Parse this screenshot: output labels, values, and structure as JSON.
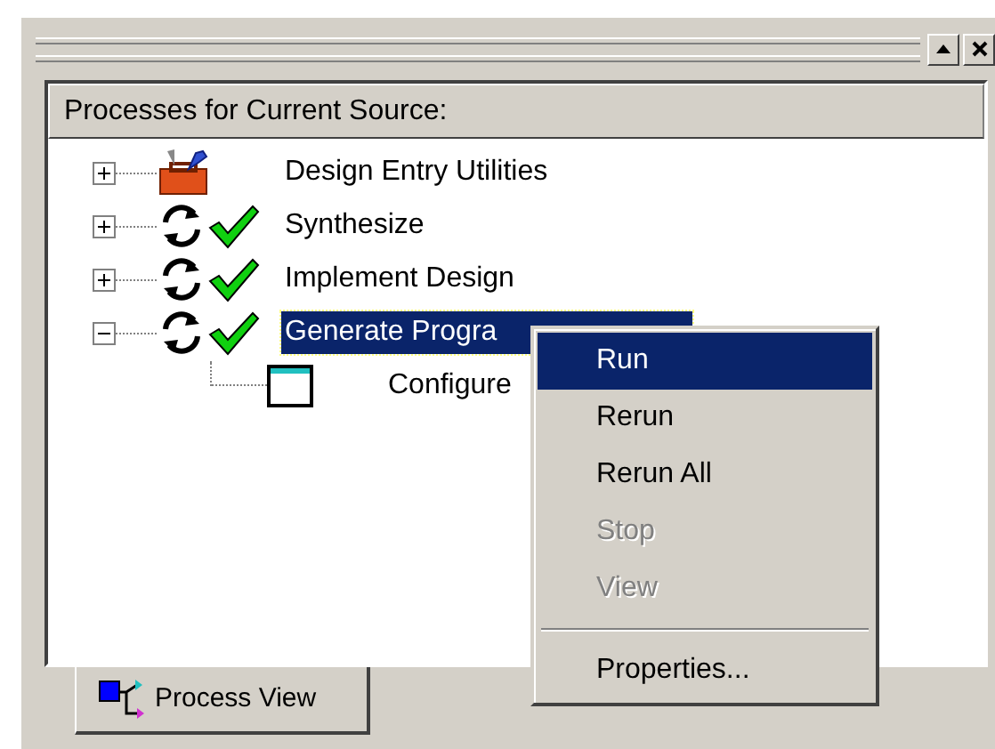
{
  "panel": {
    "header": "Processes for Current Source:"
  },
  "tree": [
    {
      "label": "Design Entry Utilities",
      "kind": "toolbox",
      "expanded": false,
      "selected": false,
      "done": false
    },
    {
      "label": "Synthesize",
      "kind": "process",
      "expanded": false,
      "selected": false,
      "done": true
    },
    {
      "label": "Implement Design",
      "kind": "process",
      "expanded": false,
      "selected": false,
      "done": true
    },
    {
      "label": "Generate Progra",
      "kind": "process",
      "expanded": true,
      "selected": true,
      "done": true,
      "children": [
        {
          "label": "Configure",
          "kind": "window",
          "selected": false
        }
      ]
    }
  ],
  "context_menu": [
    {
      "kind": "item",
      "label": "Run",
      "selected": true,
      "disabled": false
    },
    {
      "kind": "item",
      "label": "Rerun",
      "selected": false,
      "disabled": false
    },
    {
      "kind": "item",
      "label": "Rerun All",
      "selected": false,
      "disabled": false
    },
    {
      "kind": "item",
      "label": "Stop",
      "selected": false,
      "disabled": true
    },
    {
      "kind": "item",
      "label": "View",
      "selected": false,
      "disabled": true
    },
    {
      "kind": "separator"
    },
    {
      "kind": "item",
      "label": "Properties...",
      "selected": false,
      "disabled": false
    }
  ],
  "tabs": [
    {
      "label": "Process View",
      "selected": true
    }
  ]
}
